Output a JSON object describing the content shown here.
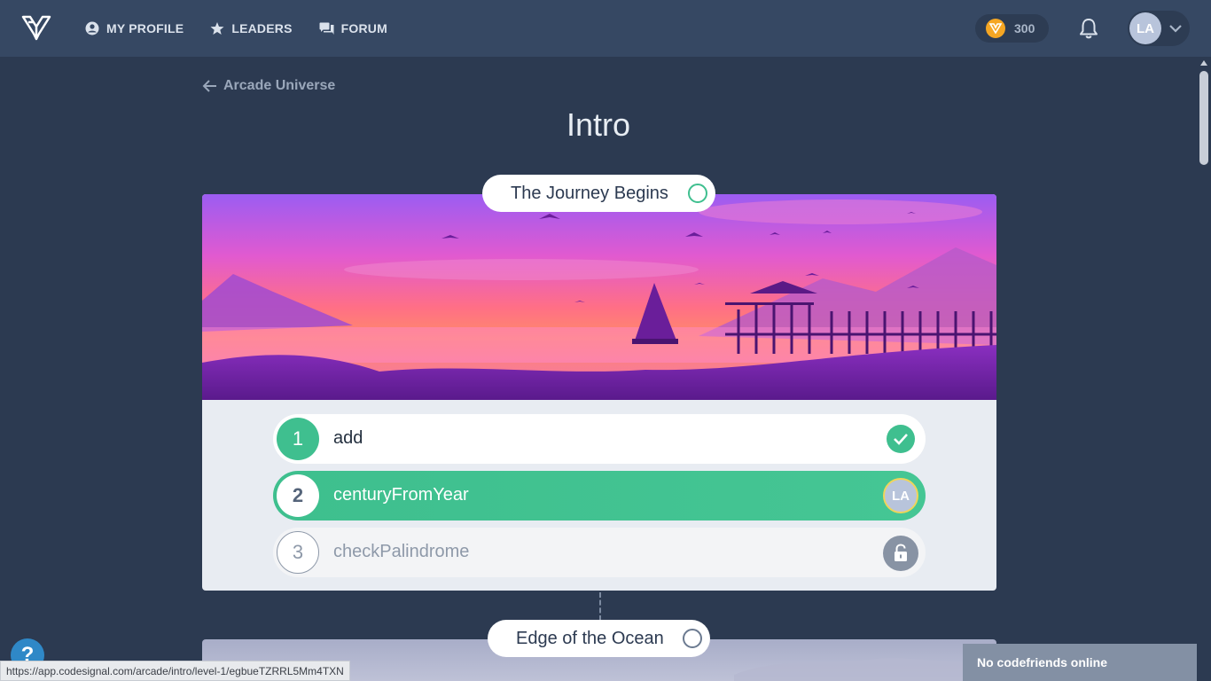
{
  "nav": {
    "profile": "MY PROFILE",
    "leaders": "LEADERS",
    "forum": "FORUM"
  },
  "header": {
    "coins": "300",
    "avatar_initials": "LA"
  },
  "breadcrumb": {
    "back_label": "Arcade Universe"
  },
  "page": {
    "title": "Intro"
  },
  "levels": [
    {
      "title": "The Journey Begins",
      "tasks": [
        {
          "num": "1",
          "name": "add",
          "state": "completed"
        },
        {
          "num": "2",
          "name": "centuryFromYear",
          "state": "current",
          "avatar": "LA"
        },
        {
          "num": "3",
          "name": "checkPalindrome",
          "state": "unlocked"
        }
      ]
    },
    {
      "title": "Edge of the Ocean"
    }
  ],
  "footer": {
    "status_url": "https://app.codesignal.com/arcade/intro/level-1/egbueTZRRL5Mm4TXN",
    "friends": "No codefriends online",
    "help": "?"
  },
  "colors": {
    "accent": "#3fbf8f",
    "background": "#2c3a51",
    "topbar": "#364863"
  }
}
